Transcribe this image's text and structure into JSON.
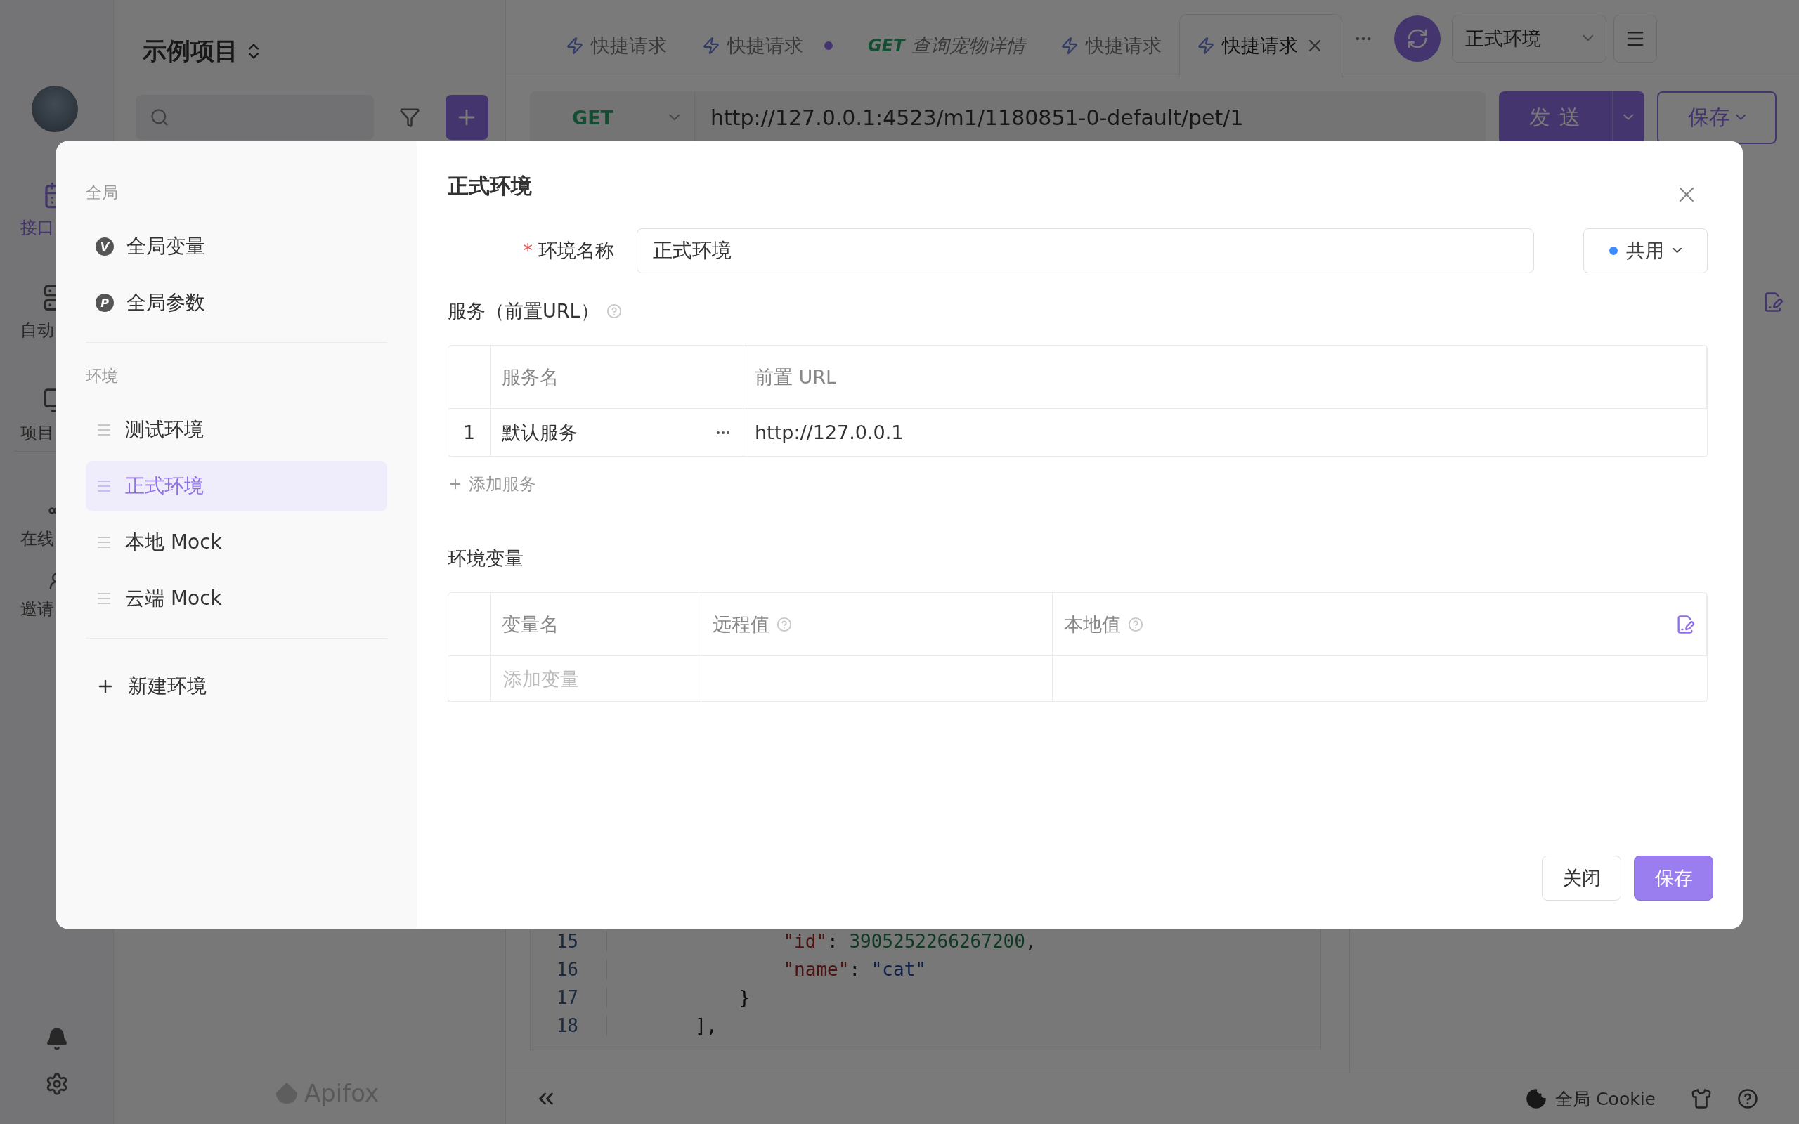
{
  "rail": {
    "items": [
      {
        "label": "接口",
        "kind": "api",
        "selected": true
      },
      {
        "label": "自动",
        "kind": "automation",
        "selected": false
      },
      {
        "label": "项目",
        "kind": "settings",
        "selected": false
      },
      {
        "label": "在线",
        "kind": "share",
        "selected": false
      },
      {
        "label": "邀请",
        "kind": "invite",
        "selected": false
      }
    ]
  },
  "project": {
    "title": "示例项目",
    "logo": "Apifox"
  },
  "tabs": [
    {
      "kind": "quick",
      "label": "快捷请求",
      "selected": false,
      "unsaved": false
    },
    {
      "kind": "quick",
      "label": "快捷请求",
      "selected": false,
      "unsaved": true
    },
    {
      "kind": "preview",
      "method": "GET",
      "label": "查询宠物详情",
      "selected": false,
      "unsaved": false
    },
    {
      "kind": "quick",
      "label": "快捷请求",
      "selected": false,
      "unsaved": false
    },
    {
      "kind": "quick",
      "label": "快捷请求",
      "selected": true,
      "unsaved": false
    }
  ],
  "environment_select": {
    "value": "正式环境"
  },
  "request": {
    "method": "GET",
    "url": "http://127.0.0.1:4523/m1/1180851-0-default/pet/1",
    "send": "发 送",
    "save": "保存"
  },
  "code": {
    "lines": [
      {
        "number": "15",
        "tokens": [
          {
            "kind": "key",
            "text": "                \"id\""
          },
          {
            "kind": "punct",
            "text": ": "
          },
          {
            "kind": "number",
            "text": "3905252266267200"
          },
          {
            "kind": "punct",
            "text": ","
          }
        ]
      },
      {
        "number": "16",
        "tokens": [
          {
            "kind": "key",
            "text": "                \"name\""
          },
          {
            "kind": "punct",
            "text": ": "
          },
          {
            "kind": "string",
            "text": "\"cat\""
          }
        ]
      },
      {
        "number": "17",
        "tokens": [
          {
            "kind": "punct",
            "text": "            }"
          }
        ]
      },
      {
        "number": "18",
        "tokens": [
          {
            "kind": "punct",
            "text": "        ],"
          }
        ]
      }
    ]
  },
  "footer": {
    "cookie": "全局 Cookie"
  },
  "modal": {
    "nav": {
      "sections": [
        {
          "heading": "全局",
          "items": [
            {
              "kind": "global",
              "badge": "V",
              "label": "全局变量",
              "selected": false
            },
            {
              "kind": "global",
              "badge": "P",
              "label": "全局参数",
              "selected": false
            }
          ]
        },
        {
          "heading": "环境",
          "items": [
            {
              "kind": "env",
              "label": "测试环境",
              "selected": false
            },
            {
              "kind": "env",
              "label": "正式环境",
              "selected": true
            },
            {
              "kind": "env",
              "label": "本地 Mock",
              "selected": false
            },
            {
              "kind": "env",
              "label": "云端 Mock",
              "selected": false
            }
          ]
        }
      ],
      "add": "新建环境"
    },
    "title": "正式环境",
    "name_field": {
      "required": true,
      "required_mark": "*",
      "label": "环境名称",
      "value": "正式环境"
    },
    "scope": {
      "label": "共用",
      "color": "#3d8bfd"
    },
    "services": {
      "heading": "服务（前置URL）",
      "columns": [
        "服务名",
        "前置 URL"
      ],
      "rows": [
        {
          "index": "1",
          "name": "默认服务",
          "url": "http://127.0.0.1"
        }
      ],
      "add": "添加服务"
    },
    "variables": {
      "heading": "环境变量",
      "columns": [
        {
          "label": "变量名",
          "help": false
        },
        {
          "label": "远程值",
          "help": true
        },
        {
          "label": "本地值",
          "help": true
        }
      ],
      "placeholder": "添加变量"
    },
    "buttons": {
      "close": "关闭",
      "save": "保存"
    }
  }
}
